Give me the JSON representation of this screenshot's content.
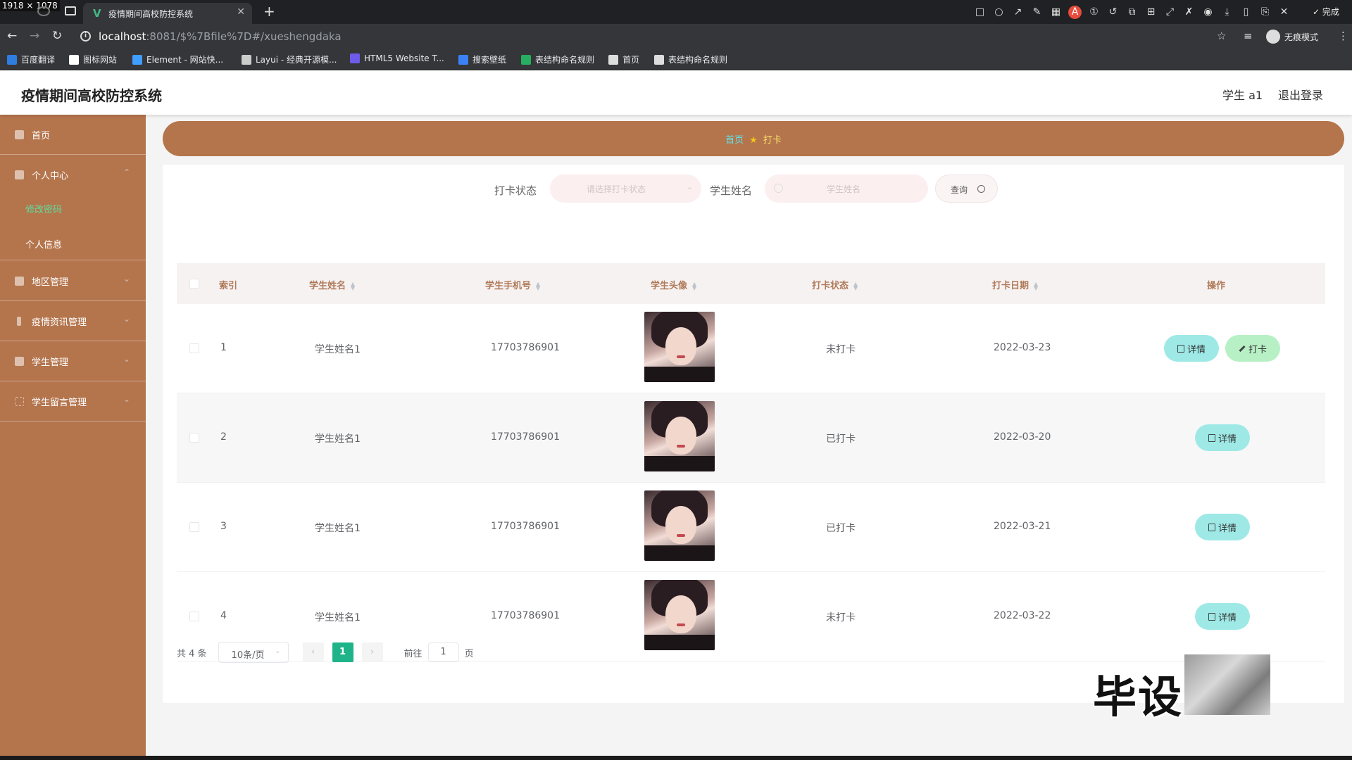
{
  "screen_label": "1918 × 1078",
  "browser": {
    "tab_title": "疫情期间高校防控系统",
    "url_host": "localhost",
    "url_rest": ":8081/$%7Bfile%7D#/xueshengdaka",
    "incognito_label": "无痕模式",
    "done_label": "完成",
    "bookmarks": [
      {
        "label": "百度翻译",
        "color": "#2f7de1"
      },
      {
        "label": "图标网站",
        "color": "#ffffff"
      },
      {
        "label": "Element - 网站快...",
        "color": "#409eff"
      },
      {
        "label": "Layui - 经典开源模...",
        "color": "#cccccc"
      },
      {
        "label": "HTML5 Website T...",
        "color": "#6c5ce7"
      },
      {
        "label": "搜索壁纸",
        "color": "#3b82f6"
      },
      {
        "label": "表结构命名规则",
        "color": "#27ae60"
      },
      {
        "label": "首页",
        "color": "#dddddd"
      },
      {
        "label": "表结构命名规则",
        "color": "#dddddd"
      }
    ]
  },
  "header": {
    "title": "疫情期间高校防控系统",
    "user": "学生 a1",
    "logout": "退出登录"
  },
  "sidebar": {
    "home": "首页",
    "personal": "个人中心",
    "personal_children": [
      "修改密码",
      "个人信息"
    ],
    "region": "地区管理",
    "news": "疫情资讯管理",
    "students": "学生管理",
    "messages": "学生留言管理"
  },
  "breadcrumb": {
    "home": "首页",
    "current": "打卡"
  },
  "filters": {
    "status_label": "打卡状态",
    "status_placeholder": "请选择打卡状态",
    "name_label": "学生姓名",
    "name_placeholder": "学生姓名",
    "query_button": "查询"
  },
  "table": {
    "columns": [
      "索引",
      "学生姓名",
      "学生手机号",
      "学生头像",
      "打卡状态",
      "打卡日期",
      "操作"
    ],
    "rows": [
      {
        "index": "1",
        "name": "学生姓名1",
        "phone": "17703786901",
        "status": "未打卡",
        "date": "2022-03-23",
        "actions": [
          "详情",
          "打卡"
        ]
      },
      {
        "index": "2",
        "name": "学生姓名1",
        "phone": "17703786901",
        "status": "已打卡",
        "date": "2022-03-20",
        "actions": [
          "详情"
        ]
      },
      {
        "index": "3",
        "name": "学生姓名1",
        "phone": "17703786901",
        "status": "已打卡",
        "date": "2022-03-21",
        "actions": [
          "详情"
        ]
      },
      {
        "index": "4",
        "name": "学生姓名1",
        "phone": "17703786901",
        "status": "未打卡",
        "date": "2022-03-22",
        "actions": [
          "详情"
        ]
      }
    ]
  },
  "pager": {
    "total": "共 4 条",
    "page_size": "10条/页",
    "current_page": "1",
    "goto_label": "前往",
    "goto_value": "1",
    "page_suffix": "页"
  },
  "watermark": {
    "text": "毕设"
  },
  "colors": {
    "sidebar": "#b4754d",
    "accent_green": "#1fb38a",
    "detail_button": "#9ee9e6",
    "punch_button": "#b8f0c6"
  }
}
